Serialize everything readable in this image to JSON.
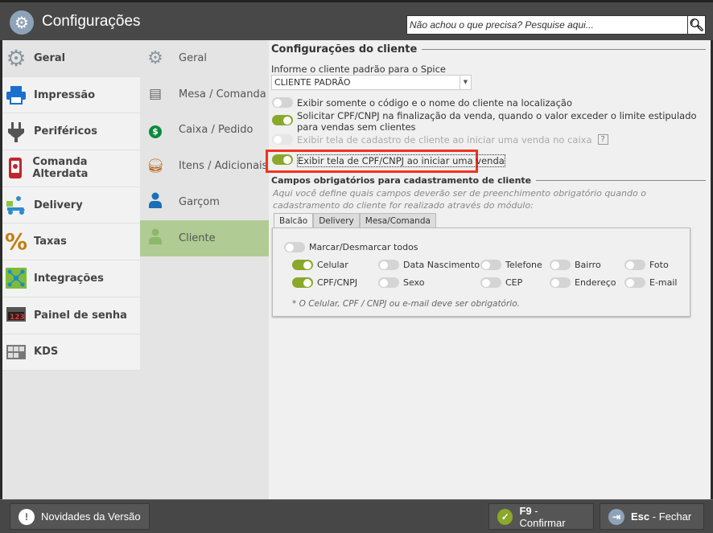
{
  "header": {
    "title": "Configurações",
    "search_placeholder": "Não achou o que precisa? Pesquise aqui..."
  },
  "sidebar": {
    "items": [
      {
        "label": "Geral",
        "icon": "gear-icon"
      },
      {
        "label": "Impressão",
        "icon": "printer-icon"
      },
      {
        "label": "Periféricos",
        "icon": "plug-icon"
      },
      {
        "label": "Comanda Alterdata",
        "icon": "phone-icon"
      },
      {
        "label": "Delivery",
        "icon": "scooter-icon"
      },
      {
        "label": "Taxas",
        "icon": "percent-icon"
      },
      {
        "label": "Integrações",
        "icon": "network-icon"
      },
      {
        "label": "Painel de senha",
        "icon": "display-icon"
      },
      {
        "label": "KDS",
        "icon": "kds-icon"
      }
    ]
  },
  "subnav": {
    "items": [
      {
        "label": "Geral"
      },
      {
        "label": "Mesa / Comanda"
      },
      {
        "label": "Caixa / Pedido"
      },
      {
        "label": "Itens / Adicionais"
      },
      {
        "label": "Garçom"
      },
      {
        "label": "Cliente"
      }
    ]
  },
  "main": {
    "section1": "Configurações do cliente",
    "default_client_label": "Informe o cliente padrão para o Spice",
    "default_client_value": "CLIENTE PADRÃO",
    "opt1": "Exibir somente o código e o nome do cliente na localização",
    "opt2": "Solicitar CPF/CNPJ na finalização da venda, quando o valor exceder o limite estipulado para vendas sem clientes",
    "opt3": "Exibir tela de cadastro de cliente ao iniciar uma venda no caixa",
    "opt3_help": "?",
    "opt4": "Exibir tela de CPF/CNPJ ao iniciar uma venda",
    "section2": "Campos obrigatórios para cadastramento de cliente",
    "section2_desc": "Aqui você define quais campos deverão ser de preenchimento obrigatório quando o cadastramento do cliente for realizado através do módulo:",
    "tabs": [
      "Balcão",
      "Delivery",
      "Mesa/Comanda"
    ],
    "toggle_all": "Marcar/Desmarcar todos",
    "fields": [
      {
        "label": "Celular",
        "on": true
      },
      {
        "label": "Data Nascimento",
        "on": false
      },
      {
        "label": "Telefone",
        "on": false
      },
      {
        "label": "Bairro",
        "on": false
      },
      {
        "label": "Foto",
        "on": false
      },
      {
        "label": "CPF/CNPJ",
        "on": true
      },
      {
        "label": "Sexo",
        "on": false
      },
      {
        "label": "CEP",
        "on": false
      },
      {
        "label": "Endereço",
        "on": false
      },
      {
        "label": "E-mail",
        "on": false
      }
    ],
    "note": "* O Celular, CPF / CNPJ ou e-mail deve ser obrigatório."
  },
  "footer": {
    "news": "Novidades da Versão",
    "confirm_key": "F9",
    "confirm": " - Confirmar",
    "close_key": "Esc",
    "close": " - Fechar"
  }
}
